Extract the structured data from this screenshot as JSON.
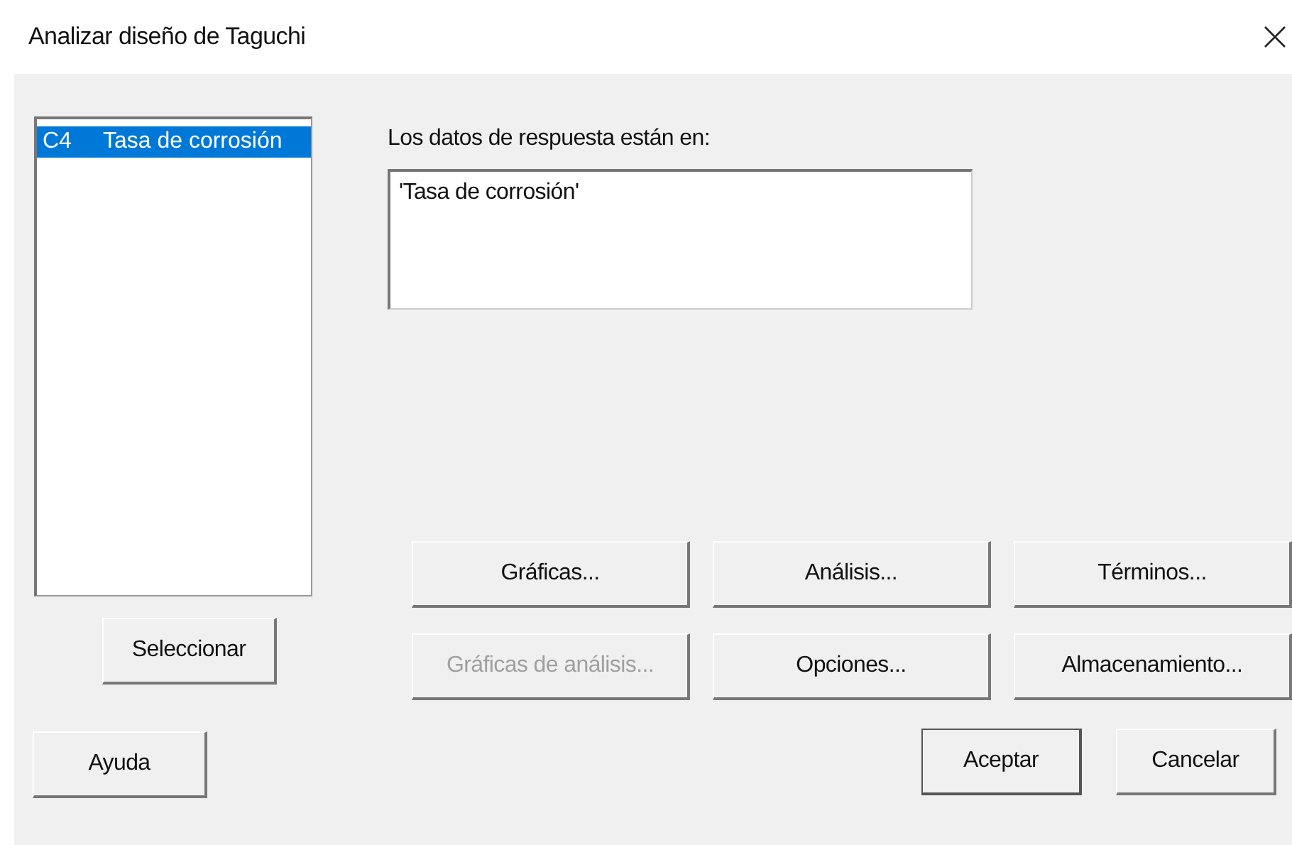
{
  "window": {
    "title": "Analizar diseño de Taguchi"
  },
  "variables": [
    {
      "column": "C4",
      "name": "Tasa de corrosión",
      "selected": true
    }
  ],
  "select_button": {
    "label": "Seleccionar",
    "disabled": false
  },
  "response": {
    "label": "Los datos de respuesta están en:",
    "value": "'Tasa de corrosión'"
  },
  "option_buttons": [
    {
      "label": "Gráficas...",
      "disabled": false
    },
    {
      "label": "Análisis...",
      "disabled": false
    },
    {
      "label": "Términos...",
      "disabled": false
    },
    {
      "label": "Gráficas de análisis...",
      "disabled": true
    },
    {
      "label": "Opciones...",
      "disabled": false
    },
    {
      "label": "Almacenamiento...",
      "disabled": false
    }
  ],
  "help_button": {
    "label": "Ayuda"
  },
  "dialog_buttons": [
    {
      "label": "Aceptar",
      "default": true
    },
    {
      "label": "Cancelar",
      "default": false
    }
  ]
}
